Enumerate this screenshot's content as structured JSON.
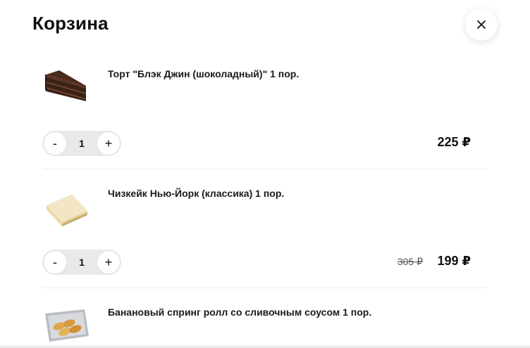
{
  "cart": {
    "title": "Корзина",
    "close_icon": "close-icon",
    "currency": "₽",
    "items": [
      {
        "name": "Торт \"Блэк Джин (шоколадный)\" 1 пор.",
        "image": "chocolate-cake-slice",
        "quantity": "1",
        "price": "225 ₽",
        "old_price": ""
      },
      {
        "name": "Чизкейк Нью-Йорк (классика) 1 пор.",
        "image": "cheesecake-slice",
        "quantity": "1",
        "price": "199 ₽",
        "old_price": "305 ₽"
      },
      {
        "name": "Банановый спринг ролл со сливочным соусом 1 пор.",
        "image": "banana-spring-roll-tray",
        "quantity": "",
        "price": "",
        "old_price": ""
      }
    ],
    "qty_minus_label": "-",
    "qty_plus_label": "+"
  }
}
